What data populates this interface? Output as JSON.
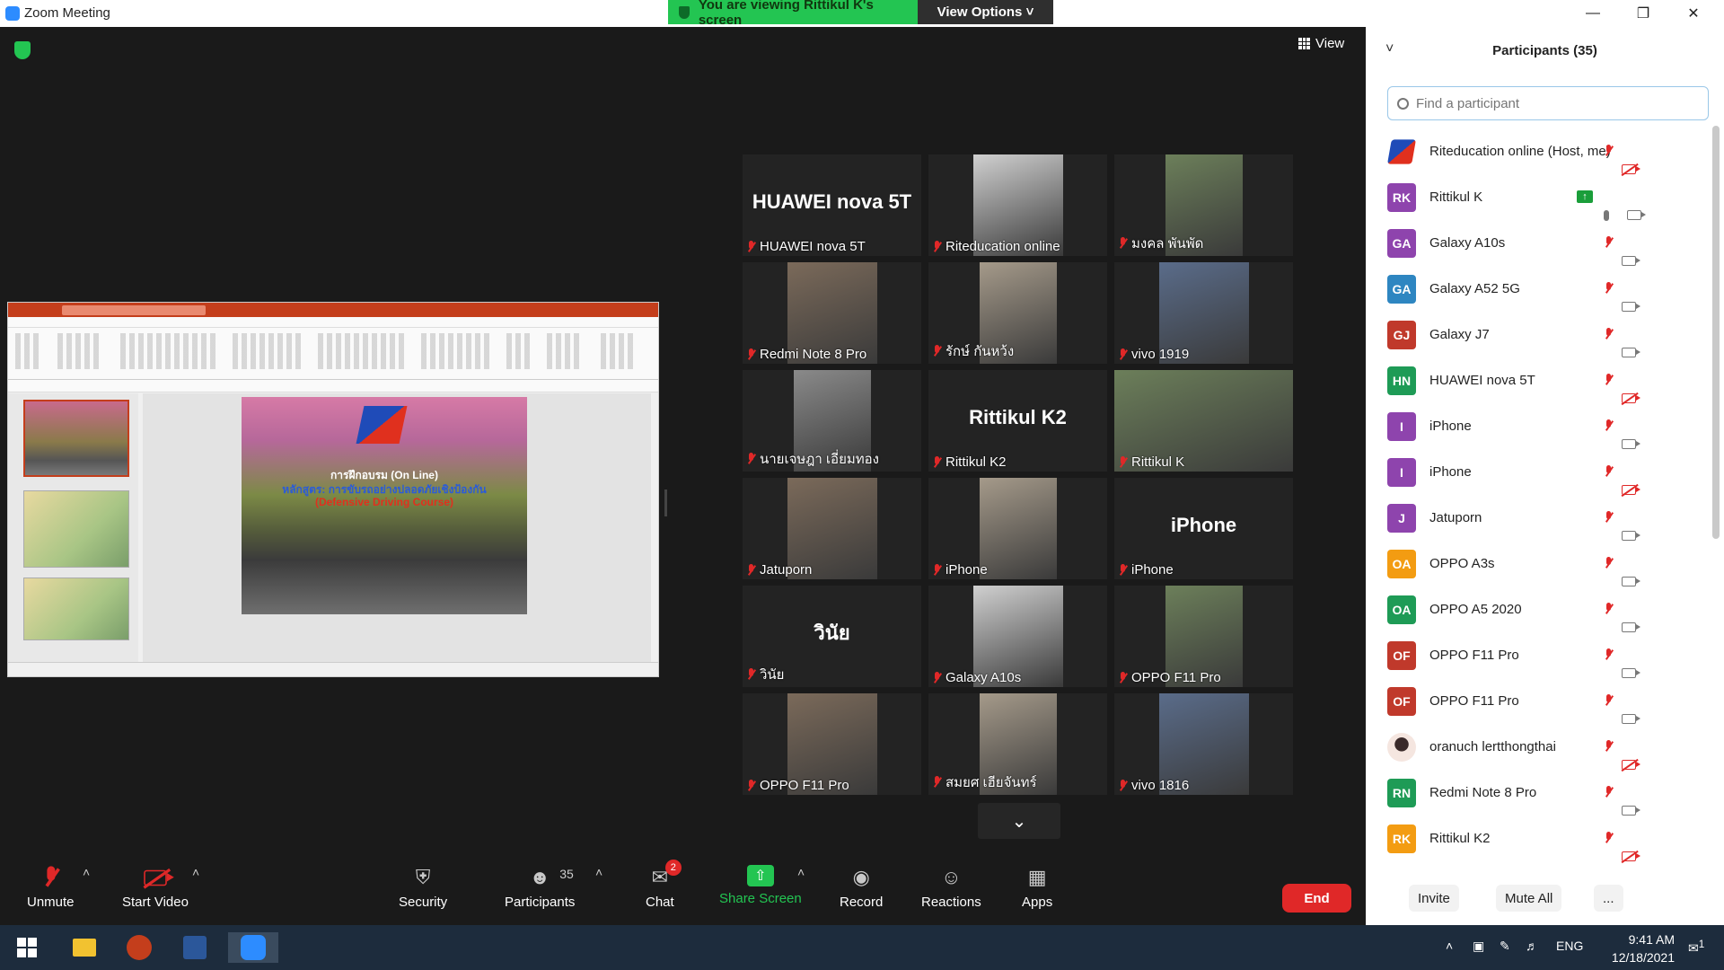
{
  "window": {
    "title": "Zoom Meeting",
    "icon": "zoom-app-icon",
    "controls": [
      "minimize",
      "restore",
      "close"
    ]
  },
  "banner": {
    "viewing_text": "You are viewing Rittikul K's screen",
    "view_options": "View Options"
  },
  "main": {
    "view_label": "View",
    "scroll_icon": "chevron-down-icon"
  },
  "shared_screen": {
    "slide_title_1": "การฝึกอบรม (On Line)",
    "slide_title_2": "หลักสูตร: การขับรถอย่างปลอดภัยเชิงป้องกัน",
    "slide_title_3": "(Defensive Driving Course)"
  },
  "video_tiles": [
    {
      "label": "HUAWEI nova 5T",
      "big_name": "HUAWEI nova 5T",
      "video": false
    },
    {
      "label": "Riteducation online",
      "big_name": "",
      "video": true
    },
    {
      "label": "มงคล พันพัด",
      "big_name": "",
      "video": true
    },
    {
      "label": "Redmi Note 8 Pro",
      "big_name": "",
      "video": true
    },
    {
      "label": "รักษ์ กันหว้ง",
      "big_name": "",
      "video": true
    },
    {
      "label": "vivo 1919",
      "big_name": "",
      "video": true
    },
    {
      "label": "นายเจษฎา เอี่ยมทอง",
      "big_name": "",
      "video": true
    },
    {
      "label": "Rittikul K2",
      "big_name": "Rittikul K2",
      "video": false
    },
    {
      "label": "Rittikul K",
      "big_name": "",
      "video": true,
      "active_speaker": true
    },
    {
      "label": "Jatuporn",
      "big_name": "",
      "video": true
    },
    {
      "label": "iPhone",
      "big_name": "",
      "video": true
    },
    {
      "label": "iPhone",
      "big_name": "iPhone",
      "video": false
    },
    {
      "label": "วินัย",
      "big_name": "วินัย",
      "video": false
    },
    {
      "label": "Galaxy A10s",
      "big_name": "",
      "video": true
    },
    {
      "label": "OPPO F11 Pro",
      "big_name": "",
      "video": true
    },
    {
      "label": "OPPO F11 Pro",
      "big_name": "",
      "video": true
    },
    {
      "label": "สมยศ เฮียจันทร์",
      "big_name": "",
      "video": true
    },
    {
      "label": "vivo 1816",
      "big_name": "",
      "video": true
    }
  ],
  "participants_panel": {
    "title": "Participants (35)",
    "search_placeholder": "Find a participant",
    "participants": [
      {
        "name": "Riteducation online (Host, me)",
        "initials": "",
        "color": "#ffffff",
        "mic": "muted",
        "video": "off"
      },
      {
        "name": "Rittikul K",
        "initials": "RK",
        "color": "#8e44ad",
        "mic": "on",
        "video": "on",
        "sharing": true
      },
      {
        "name": "Galaxy A10s",
        "initials": "GA",
        "color": "#8e44ad",
        "mic": "muted",
        "video": "on"
      },
      {
        "name": "Galaxy A52 5G",
        "initials": "GA",
        "color": "#2e86c1",
        "mic": "muted",
        "video": "on"
      },
      {
        "name": "Galaxy J7",
        "initials": "GJ",
        "color": "#c0392b",
        "mic": "muted",
        "video": "on"
      },
      {
        "name": "HUAWEI nova 5T",
        "initials": "HN",
        "color": "#1e9b56",
        "mic": "muted",
        "video": "off"
      },
      {
        "name": "iPhone",
        "initials": "I",
        "color": "#8e44ad",
        "mic": "muted",
        "video": "on"
      },
      {
        "name": "iPhone",
        "initials": "I",
        "color": "#8e44ad",
        "mic": "muted",
        "video": "off"
      },
      {
        "name": "Jatuporn",
        "initials": "J",
        "color": "#8e44ad",
        "mic": "muted",
        "video": "on"
      },
      {
        "name": "OPPO A3s",
        "initials": "OA",
        "color": "#f39c12",
        "mic": "muted",
        "video": "on"
      },
      {
        "name": "OPPO A5 2020",
        "initials": "OA",
        "color": "#1e9b56",
        "mic": "muted",
        "video": "on"
      },
      {
        "name": "OPPO F11 Pro",
        "initials": "OF",
        "color": "#c0392b",
        "mic": "muted",
        "video": "on"
      },
      {
        "name": "OPPO F11 Pro",
        "initials": "OF",
        "color": "#c0392b",
        "mic": "muted",
        "video": "on"
      },
      {
        "name": "oranuch lertthongthai",
        "initials": "",
        "color": "#f5e6e0",
        "mic": "muted",
        "video": "off"
      },
      {
        "name": "Redmi Note 8 Pro",
        "initials": "RN",
        "color": "#1e9b56",
        "mic": "muted",
        "video": "on"
      },
      {
        "name": "Rittikul K2",
        "initials": "RK",
        "color": "#f39c12",
        "mic": "muted",
        "video": "off"
      }
    ],
    "invite_label": "Invite",
    "mute_all_label": "Mute All",
    "more_label": "..."
  },
  "toolbar": {
    "unmute": "Unmute",
    "start_video": "Start Video",
    "security": "Security",
    "participants": "Participants",
    "participant_count": "35",
    "chat": "Chat",
    "chat_badge": "2",
    "share_screen": "Share Screen",
    "record": "Record",
    "reactions": "Reactions",
    "apps": "Apps",
    "end": "End"
  },
  "taskbar": {
    "language": "ENG",
    "time": "9:41 AM",
    "date": "12/18/2021",
    "notification_count": "1",
    "apps": [
      "windows-start",
      "file-explorer",
      "powerpoint",
      "word",
      "zoom"
    ]
  },
  "colors": {
    "zoom_blue": "#2d8cff",
    "banner_green": "#23c552",
    "muted_red": "#e02828",
    "active_speaker": "#d9e34a"
  }
}
